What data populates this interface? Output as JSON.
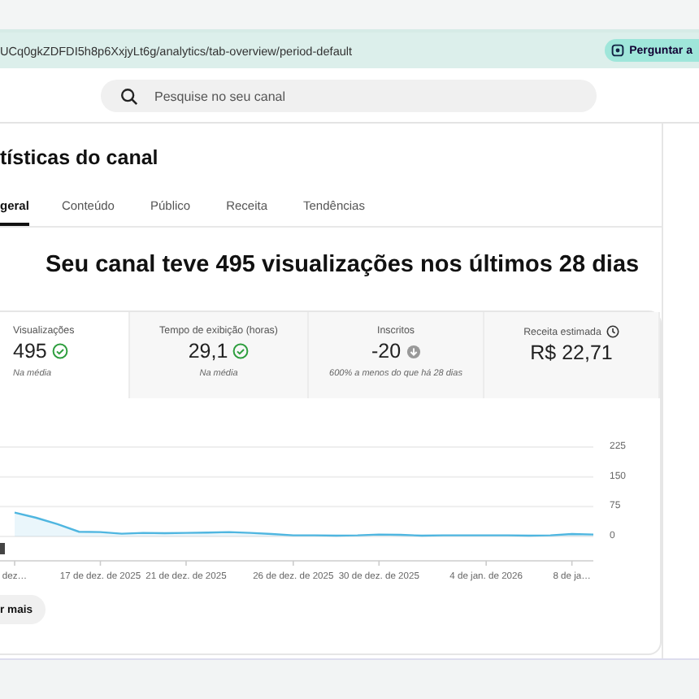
{
  "address_bar": {
    "url": "UCq0gkZDFDI5h8p6XxjyLt6g/analytics/tab-overview/period-default",
    "ask_button": "Perguntar a"
  },
  "search": {
    "placeholder": "Pesquise no seu canal"
  },
  "page_title": "tísticas do canal",
  "tabs": [
    {
      "label": "geral",
      "selected": true
    },
    {
      "label": "Conteúdo",
      "selected": false
    },
    {
      "label": "Público",
      "selected": false
    },
    {
      "label": "Receita",
      "selected": false
    },
    {
      "label": "Tendências",
      "selected": false
    }
  ],
  "headline": "Seu canal teve 495 visualizações nos últimos 28 dias",
  "metrics": [
    {
      "label": "Visualizações",
      "value": "495",
      "kind": "ok",
      "note": "Na média",
      "selected": true
    },
    {
      "label": "Tempo de exibição (horas)",
      "value": "29,1",
      "kind": "ok",
      "note": "Na média",
      "selected": false
    },
    {
      "label": "Inscritos",
      "value": "-20",
      "kind": "down",
      "note": "600% a menos do que há 28 dias",
      "selected": false
    },
    {
      "label": "Receita estimada",
      "value": "R$ 22,71",
      "kind": "pending",
      "selected": false
    }
  ],
  "chart": {
    "chart_data": {
      "type": "area",
      "categories": [
        "dez…",
        null,
        null,
        null,
        "17 de dez. de 2025",
        null,
        null,
        null,
        "21 de dez. de 2025",
        null,
        null,
        null,
        null,
        "26 de dez. de 2025",
        null,
        null,
        null,
        "30 de dez. de 2025",
        null,
        null,
        null,
        null,
        "4 de jan. de 2026",
        null,
        null,
        null,
        "8 de ja…",
        null
      ],
      "yticks": [
        0,
        75,
        150,
        225
      ],
      "ylim": [
        0,
        225
      ],
      "series": [
        {
          "color": "#4fb6e0",
          "values": [
            60,
            47,
            31,
            12,
            11,
            7,
            9,
            8,
            9,
            10,
            11,
            9,
            6,
            3,
            3,
            2,
            3,
            5,
            4,
            2,
            3,
            3,
            3,
            3,
            2,
            3,
            6,
            5
          ]
        }
      ]
    }
  },
  "more_button": "r mais"
}
